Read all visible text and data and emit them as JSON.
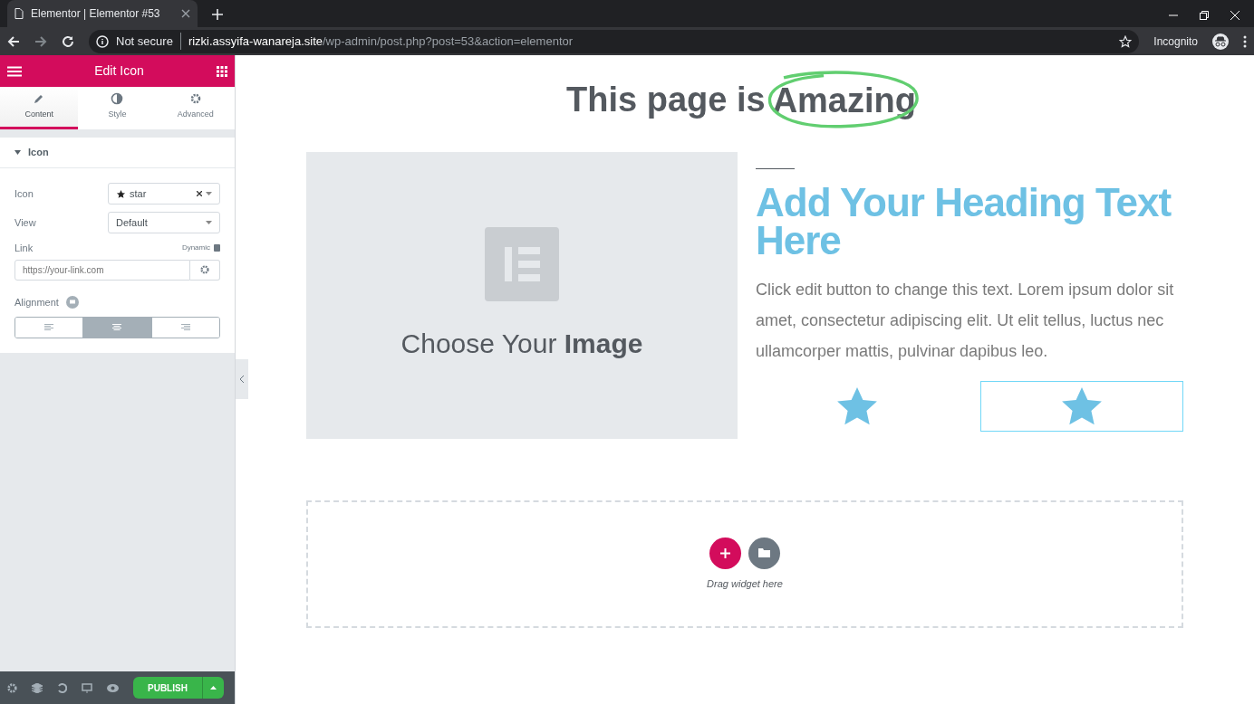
{
  "browser": {
    "tab_title": "Elementor | Elementor #53",
    "security": "Not secure",
    "url_host": "rizki.assyifa-wanareja.site",
    "url_path": "/wp-admin/post.php?post=53&action=elementor",
    "profile": "Incognito"
  },
  "panel": {
    "title": "Edit Icon",
    "tabs": [
      {
        "label": "Content",
        "kind": "pencil",
        "selected": true
      },
      {
        "label": "Style",
        "kind": "contrast",
        "selected": false
      },
      {
        "label": "Advanced",
        "kind": "gear",
        "selected": false
      }
    ],
    "section": {
      "title": "Icon",
      "expanded": true
    },
    "icon_control": {
      "label": "Icon",
      "value": "star"
    },
    "view_control": {
      "label": "View",
      "value": "Default"
    },
    "link_control": {
      "label": "Link",
      "dynamic": "Dynamic",
      "placeholder": "https://your-link.com"
    },
    "alignment_control": {
      "label": "Alignment",
      "options": [
        {
          "kind": "left",
          "selected": false
        },
        {
          "kind": "center",
          "selected": true
        },
        {
          "kind": "right",
          "selected": false
        }
      ]
    },
    "publish": "PUBLISH"
  },
  "canvas": {
    "title": "This page is",
    "highlight": "Amazing",
    "image_placeholder": "Choose Your **Image**",
    "heading": "Add Your Heading Text Here",
    "paragraph": "Click edit button to change this text. Lorem ipsum dolor sit amet, consectetur adipiscing elit. Ut elit tellus, luctus nec ullamcorper mattis, pulvinar dapibus leo.",
    "icons": [
      {
        "selected": false
      },
      {
        "selected": true
      }
    ],
    "drop_zone": "Drag widget here"
  }
}
